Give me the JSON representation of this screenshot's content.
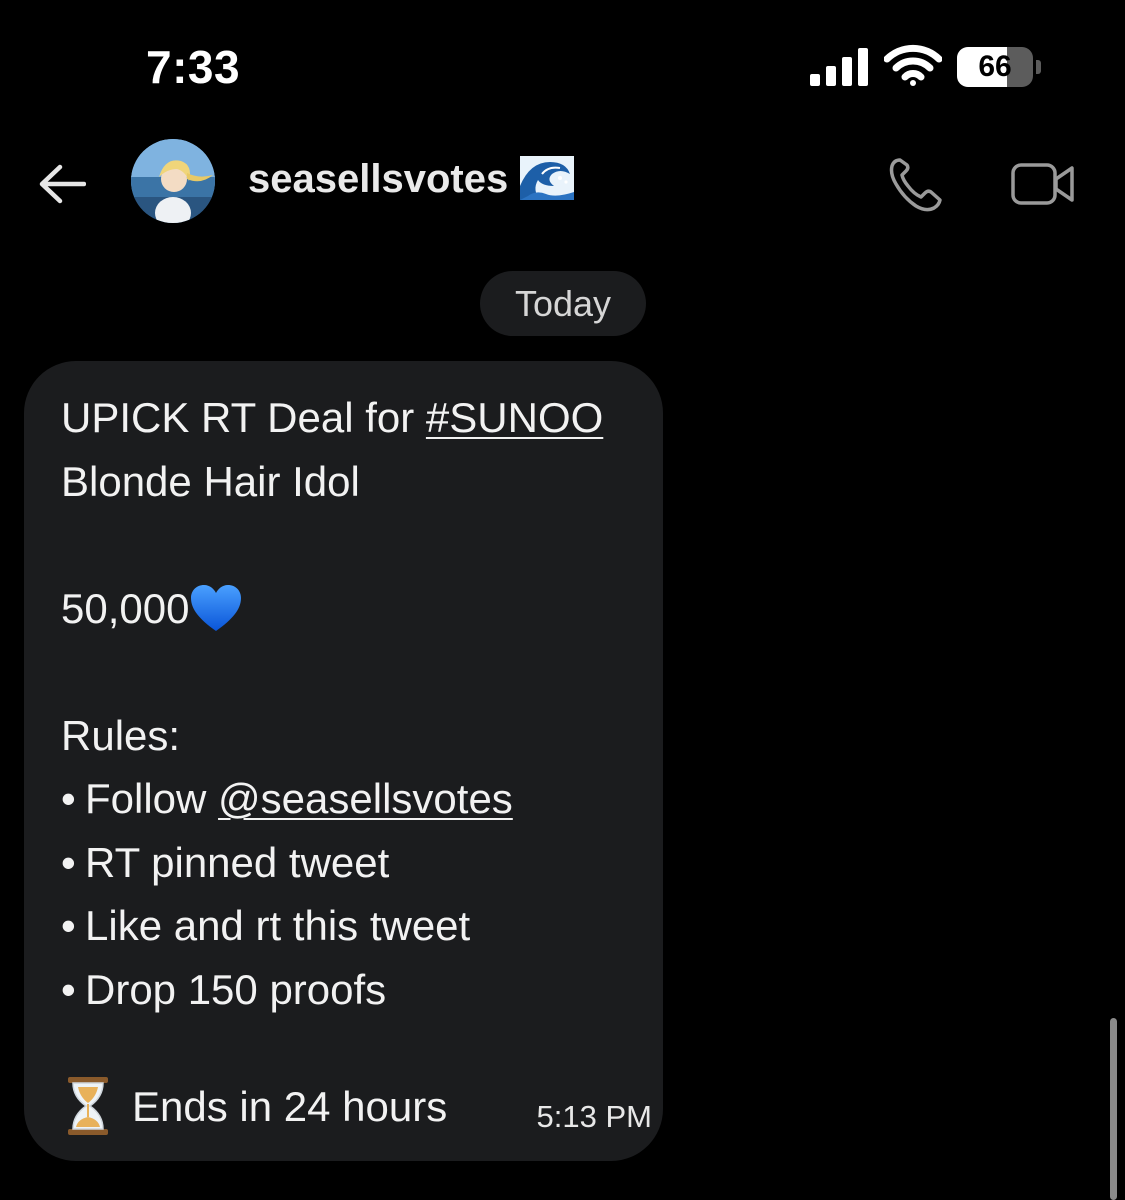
{
  "status_bar": {
    "time": "7:33",
    "battery_level": "66",
    "battery_percent": 66,
    "signal_icon": "cellular-signal-icon",
    "wifi_icon": "wifi-icon"
  },
  "header": {
    "back_icon": "back-arrow-icon",
    "contact_name": "seasellsvotes",
    "contact_emoji_icon": "wave-icon",
    "call_icon": "phone-icon",
    "video_icon": "video-camera-icon"
  },
  "conversation": {
    "date_label": "Today",
    "message": {
      "line1_prefix": "UPICK RT Deal for ",
      "hashtag": "#SUNOO",
      "line2": "Blonde Hair Idol",
      "amount": "50,000",
      "amount_emoji_icon": "blue-heart-icon",
      "rules_heading": "Rules:",
      "bullet": "•",
      "rule1_prefix": "Follow ",
      "rule1_mention": "@seasellsvotes",
      "rule2": "RT pinned tweet",
      "rule3": "Like and rt this tweet",
      "rule4": "Drop 150 proofs",
      "footer_emoji_icon": "hourglass-icon",
      "footer_text": "Ends in 24 hours",
      "timestamp": "5:13 PM"
    }
  },
  "colors": {
    "background": "#000000",
    "bubble": "#1b1c1e",
    "text": "#f2f2f2",
    "muted_icon": "#9a9a9a",
    "heart": "#1e6ff0"
  }
}
